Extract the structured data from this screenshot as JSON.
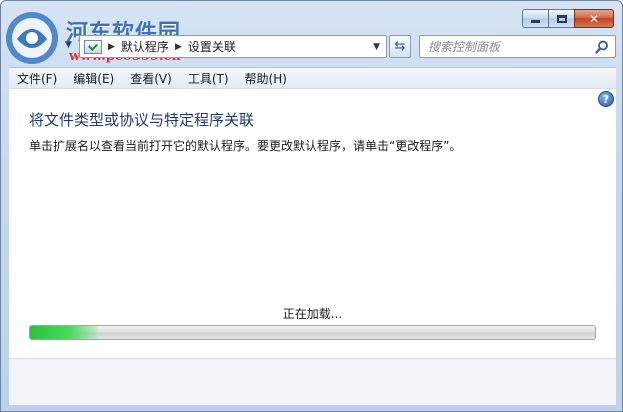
{
  "watermark": {
    "brand": "河东软件园",
    "url": "www.pc0359.cn"
  },
  "address_bar": {
    "crumbs": [
      "默认程序",
      "设置关联"
    ]
  },
  "search": {
    "placeholder": "搜索控制面板"
  },
  "menu": {
    "items": [
      "文件(F)",
      "编辑(E)",
      "查看(V)",
      "工具(T)",
      "帮助(H)"
    ]
  },
  "content": {
    "title": "将文件类型或协议与特定程序关联",
    "description": "单击扩展名以查看当前打开它的默认程序。要更改默认程序，请单击“更改程序”。",
    "loading_text": "正在加载...",
    "progress_percent": 12
  },
  "colors": {
    "accent": "#1e3a6e",
    "progress": "#27c33b",
    "close_button": "#c3431f"
  }
}
